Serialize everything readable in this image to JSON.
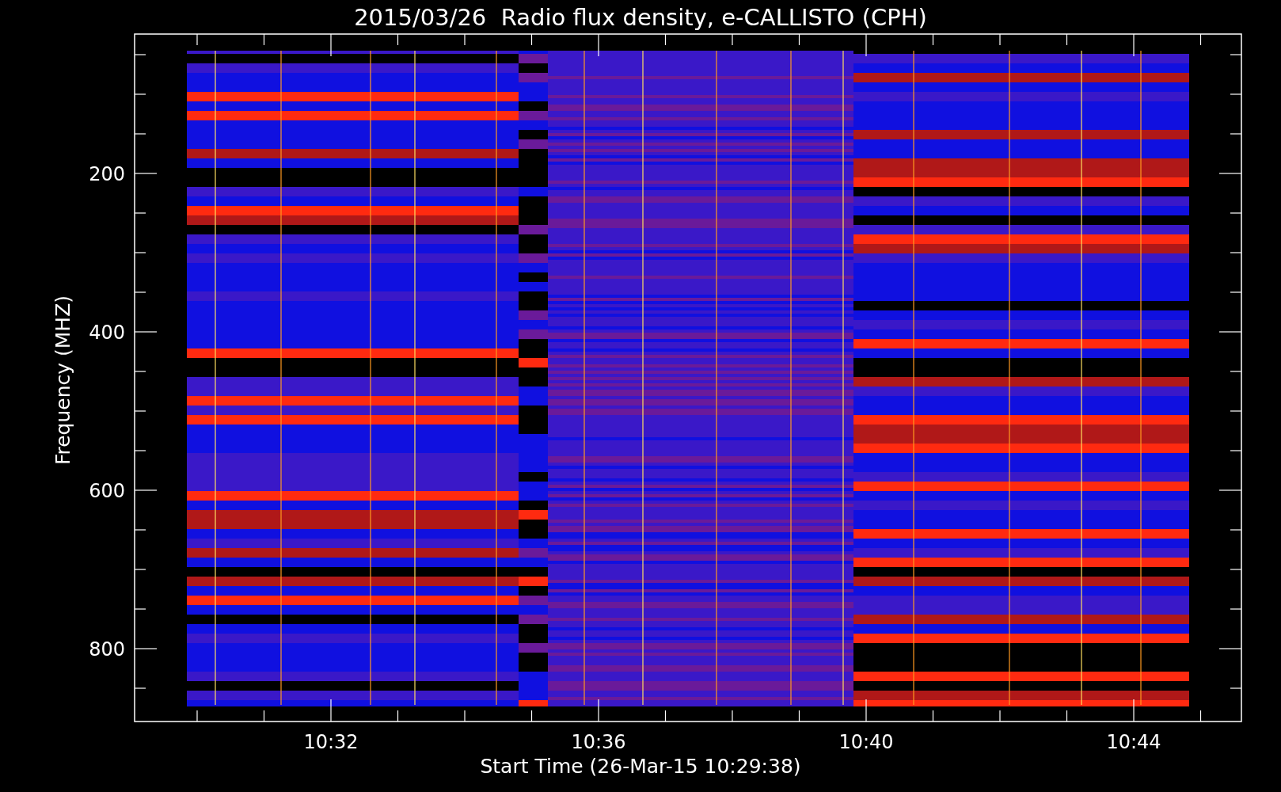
{
  "plot": {
    "title": "2015/03/26  Radio flux density, e-CALLISTO (CPH)",
    "ylabel": "Frequency (MHZ)",
    "xlabel": "Start Time (26-Mar-15 10:29:38)",
    "yticks": [
      "200",
      "400",
      "600",
      "800"
    ],
    "xticks": [
      "10:32",
      "10:36",
      "10:40",
      "10:44"
    ]
  }
}
